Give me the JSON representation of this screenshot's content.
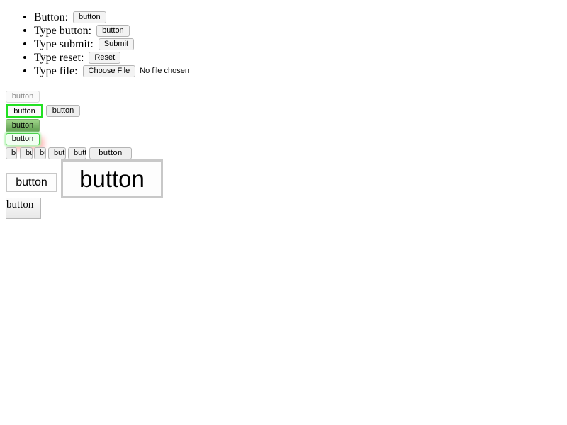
{
  "list": {
    "items": [
      {
        "label": "Button:",
        "button": "button"
      },
      {
        "label": "Type button:",
        "button": "button"
      },
      {
        "label": "Type submit:",
        "button": "Submit"
      },
      {
        "label": "Type reset:",
        "button": "Reset"
      },
      {
        "label": "Type file:",
        "button": "Choose File",
        "status": "No file chosen"
      }
    ]
  },
  "buttons": {
    "disabled": "button",
    "green_border": "button",
    "plain": "button",
    "gradient": "button",
    "glow": "button",
    "clipped": [
      "bu",
      "bu",
      "bu",
      "but",
      "butt",
      "button"
    ],
    "medium": "button",
    "large": "button",
    "serif": "button"
  },
  "colors": {
    "green_border": "#22e022",
    "gradient_top": "#9fd58a",
    "gradient_bottom": "#5d9b4d",
    "glow": "#b9f5b9",
    "shadow": "#ff7878"
  }
}
